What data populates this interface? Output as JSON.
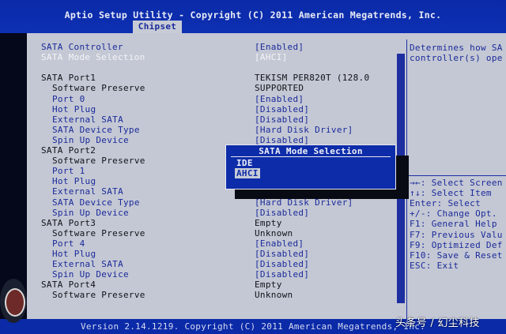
{
  "header": {
    "title": "Aptio Setup Utility - Copyright (C) 2011 American Megatrends, Inc.",
    "tab": "Chipset"
  },
  "settings": [
    {
      "label": "SATA Controller",
      "value": "[Enabled]",
      "level": "top",
      "style": "blue"
    },
    {
      "label": "SATA Mode Selection",
      "value": "[AHCI]",
      "level": "top",
      "style": "white"
    },
    {
      "label": "",
      "value": "",
      "level": "top",
      "style": "blue"
    },
    {
      "label": "SATA Port1",
      "value": "TEKISM PER820T (128.0",
      "level": "top",
      "style": "black"
    },
    {
      "label": "Software Preserve",
      "value": "SUPPORTED",
      "level": "ind",
      "style": "black"
    },
    {
      "label": "Port 0",
      "value": "[Enabled]",
      "level": "ind",
      "style": "blue"
    },
    {
      "label": "Hot Plug",
      "value": "[Disabled]",
      "level": "ind",
      "style": "blue"
    },
    {
      "label": "External SATA",
      "value": "[Disabled]",
      "level": "ind",
      "style": "blue"
    },
    {
      "label": "SATA Device Type",
      "value": "[Hard Disk Driver]",
      "level": "ind",
      "style": "blue"
    },
    {
      "label": "Spin Up Device",
      "value": "[Disabled]",
      "level": "ind",
      "style": "blue"
    },
    {
      "label": "SATA Port2",
      "value": "",
      "level": "top",
      "style": "black"
    },
    {
      "label": "Software Preserve",
      "value": "",
      "level": "ind",
      "style": "black"
    },
    {
      "label": "Port 1",
      "value": "",
      "level": "ind",
      "style": "blue"
    },
    {
      "label": "Hot Plug",
      "value": "",
      "level": "ind",
      "style": "blue"
    },
    {
      "label": "External SATA",
      "value": "",
      "level": "ind",
      "style": "blue"
    },
    {
      "label": "SATA Device Type",
      "value": "[Hard Disk Driver]",
      "level": "ind",
      "style": "blue"
    },
    {
      "label": "Spin Up Device",
      "value": "[Disabled]",
      "level": "ind",
      "style": "blue"
    },
    {
      "label": "SATA Port3",
      "value": "Empty",
      "level": "top",
      "style": "black"
    },
    {
      "label": "Software Preserve",
      "value": "Unknown",
      "level": "ind",
      "style": "black"
    },
    {
      "label": "Port 4",
      "value": "[Enabled]",
      "level": "ind",
      "style": "blue"
    },
    {
      "label": "Hot Plug",
      "value": "[Disabled]",
      "level": "ind",
      "style": "blue"
    },
    {
      "label": "External SATA",
      "value": "[Disabled]",
      "level": "ind",
      "style": "blue"
    },
    {
      "label": "Spin Up Device",
      "value": "[Disabled]",
      "level": "ind",
      "style": "blue"
    },
    {
      "label": "SATA Port4",
      "value": "Empty",
      "level": "top",
      "style": "black"
    },
    {
      "label": "Software Preserve",
      "value": "Unknown",
      "level": "ind",
      "style": "black"
    }
  ],
  "help": {
    "line1": "Determines how SA",
    "line2": "controller(s) ope"
  },
  "keys": [
    "→←: Select Screen",
    "↑↓: Select Item",
    "Enter: Select",
    "+/-: Change Opt.",
    "F1: General Help",
    "F7: Previous Valu",
    "F9: Optimized Def",
    "F10: Save & Reset",
    "ESC: Exit"
  ],
  "popup": {
    "title": "SATA Mode Selection",
    "options": [
      "IDE",
      "AHCI"
    ],
    "selected": "AHCI"
  },
  "footer": "Version 2.14.1219. Copyright (C) 2011 American Megatrends, Inc.",
  "watermark": "头条号 / 幻尘科技"
}
